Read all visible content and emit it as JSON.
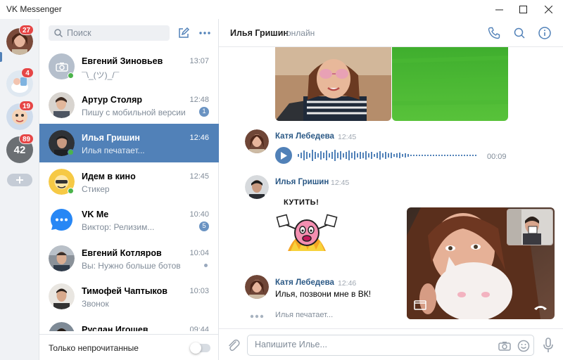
{
  "window": {
    "title": "VK Messenger"
  },
  "rail": {
    "items": [
      {
        "badge": "27"
      },
      {
        "badge": "4"
      },
      {
        "badge": "19"
      },
      {
        "badge": "89",
        "avatar_text": "42"
      }
    ]
  },
  "list": {
    "search_placeholder": "Поиск",
    "chats": [
      {
        "name": "Евгений Зиновьев",
        "time": "13:07",
        "preview": "¯\\_(ツ)_/¯",
        "online": true
      },
      {
        "name": "Артур Столяр",
        "time": "12:48",
        "preview": "Пишу с мобильной версии",
        "unread": "1"
      },
      {
        "name": "Илья Гришин",
        "time": "12:46",
        "preview": "Илья печатает...",
        "online": true,
        "active": true
      },
      {
        "name": "Идем в кино",
        "time": "12:45",
        "preview": "Стикер",
        "online": true
      },
      {
        "name": "VK Me",
        "time": "10:40",
        "preview": "Виктор: Релизим...",
        "unread": "5"
      },
      {
        "name": "Евгений Котляров",
        "time": "10:04",
        "preview": "Вы: Нужно больше ботов",
        "dot": true
      },
      {
        "name": "Тимофей Чаптыков",
        "time": "10:03",
        "preview": "Звонок"
      },
      {
        "name": "Руслан Игошев",
        "time": "09:44",
        "preview": ""
      }
    ],
    "footer_label": "Только непрочитанные"
  },
  "conversation": {
    "name": "Илья Гришин",
    "status": "онлайн",
    "messages": [
      {
        "author": "Катя Лебедева",
        "time": "12:45",
        "voice_duration": "00:09"
      },
      {
        "author": "Илья Гришин",
        "time": "12:45",
        "sticker_text": "КУТИТЬ!"
      },
      {
        "author": "Катя Лебедева",
        "time": "12:46",
        "text": "Илья, позвони мне в ВК!"
      }
    ],
    "typing": "Илья печатает...",
    "input_placeholder": "Напишите Илье..."
  },
  "colors": {
    "accent": "#5181b8",
    "badge": "#e64646",
    "online": "#4bb34b",
    "author": "#2a5885"
  }
}
